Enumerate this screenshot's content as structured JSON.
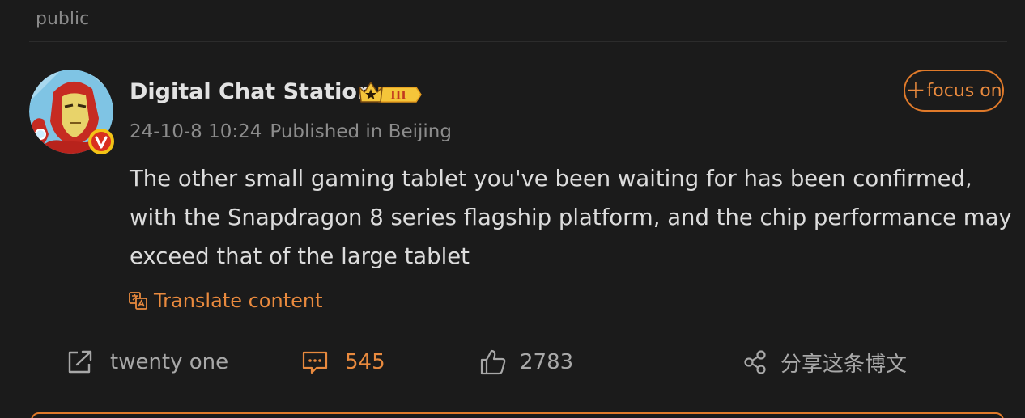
{
  "section": {
    "label": "public"
  },
  "author": {
    "name": "Digital Chat Station",
    "level_badge": "III"
  },
  "follow": {
    "label": "focus on",
    "icon": "plus-icon"
  },
  "post": {
    "date": "24-10-8 10:24",
    "location": "Published in Beijing",
    "text": "The other small gaming tablet you've been waiting for has been confirmed, with the Snapdragon 8 series flagship platform, and the chip performance may exceed that of the large tablet"
  },
  "translate": {
    "label": "Translate content",
    "icon": "translate-icon"
  },
  "actions": {
    "repost": {
      "label": "twenty one",
      "icon": "repost-icon"
    },
    "comment": {
      "label": "545",
      "icon": "comment-icon"
    },
    "like": {
      "label": "2783",
      "icon": "thumbs-up-icon"
    },
    "share": {
      "label": "分享这条博文",
      "icon": "share-icon"
    }
  },
  "colors": {
    "background": "#1b1b1b",
    "accent": "#e98a3e",
    "text": "#dcdcdc",
    "muted": "#8c8c8c"
  }
}
